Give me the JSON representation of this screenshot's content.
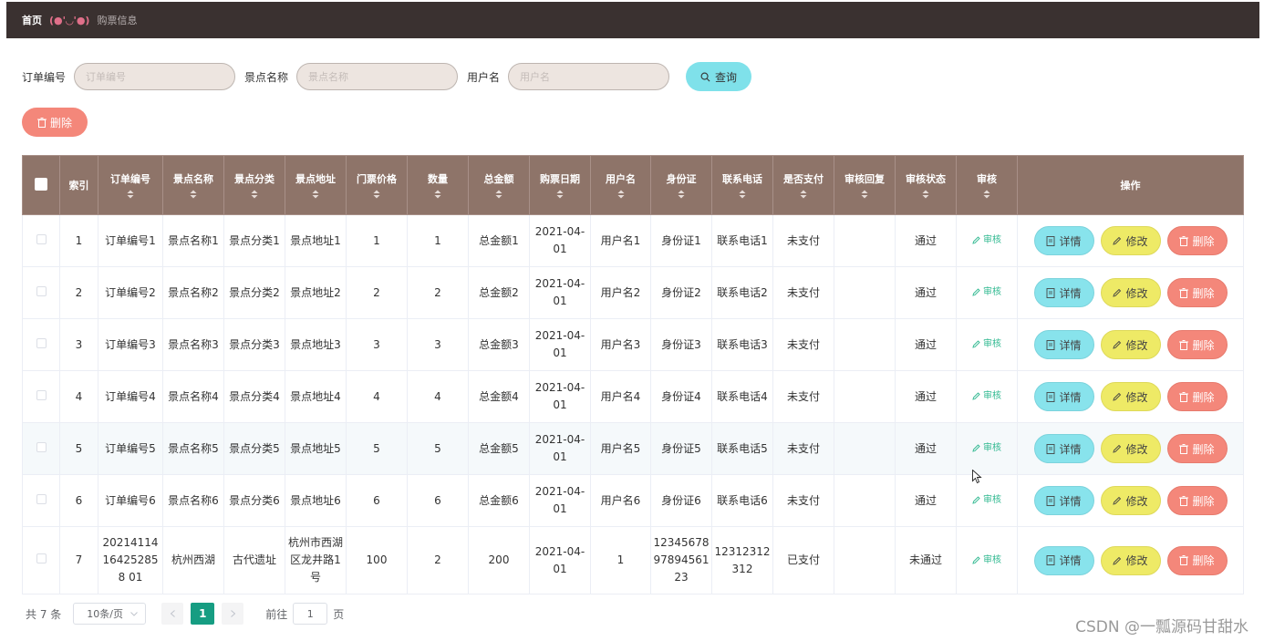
{
  "breadcrumb": {
    "home": "首页",
    "face": "(●'◡'●)",
    "current": "购票信息"
  },
  "search": {
    "order_label": "订单编号",
    "order_placeholder": "订单编号",
    "spot_label": "景点名称",
    "spot_placeholder": "景点名称",
    "user_label": "用户名",
    "user_placeholder": "用户名",
    "query_label": "查询"
  },
  "toolbar": {
    "delete_label": "删除"
  },
  "table": {
    "headers": [
      "索引",
      "订单编号",
      "景点名称",
      "景点分类",
      "景点地址",
      "门票价格",
      "数量",
      "总金额",
      "购票日期",
      "用户名",
      "身份证",
      "联系电话",
      "是否支付",
      "审核回复",
      "审核状态",
      "审核",
      "操作"
    ],
    "rows": [
      {
        "index": "1",
        "order": "订单编号1",
        "spot": "景点名称1",
        "category": "景点分类1",
        "address": "景点地址1",
        "price": "1",
        "qty": "1",
        "total": "总金额1",
        "date": "2021-04-01",
        "user": "用户名1",
        "id_card": "身份证1",
        "phone": "联系电话1",
        "paid": "未支付",
        "reply": "",
        "status": "通过",
        "audit": "审核"
      },
      {
        "index": "2",
        "order": "订单编号2",
        "spot": "景点名称2",
        "category": "景点分类2",
        "address": "景点地址2",
        "price": "2",
        "qty": "2",
        "total": "总金额2",
        "date": "2021-04-01",
        "user": "用户名2",
        "id_card": "身份证2",
        "phone": "联系电话2",
        "paid": "未支付",
        "reply": "",
        "status": "通过",
        "audit": "审核"
      },
      {
        "index": "3",
        "order": "订单编号3",
        "spot": "景点名称3",
        "category": "景点分类3",
        "address": "景点地址3",
        "price": "3",
        "qty": "3",
        "total": "总金额3",
        "date": "2021-04-01",
        "user": "用户名3",
        "id_card": "身份证3",
        "phone": "联系电话3",
        "paid": "未支付",
        "reply": "",
        "status": "通过",
        "audit": "审核"
      },
      {
        "index": "4",
        "order": "订单编号4",
        "spot": "景点名称4",
        "category": "景点分类4",
        "address": "景点地址4",
        "price": "4",
        "qty": "4",
        "total": "总金额4",
        "date": "2021-04-01",
        "user": "用户名4",
        "id_card": "身份证4",
        "phone": "联系电话4",
        "paid": "未支付",
        "reply": "",
        "status": "通过",
        "audit": "审核"
      },
      {
        "index": "5",
        "order": "订单编号5",
        "spot": "景点名称5",
        "category": "景点分类5",
        "address": "景点地址5",
        "price": "5",
        "qty": "5",
        "total": "总金额5",
        "date": "2021-04-01",
        "user": "用户名5",
        "id_card": "身份证5",
        "phone": "联系电话5",
        "paid": "未支付",
        "reply": "",
        "status": "通过",
        "audit": "审核"
      },
      {
        "index": "6",
        "order": "订单编号6",
        "spot": "景点名称6",
        "category": "景点分类6",
        "address": "景点地址6",
        "price": "6",
        "qty": "6",
        "total": "总金额6",
        "date": "2021-04-01",
        "user": "用户名6",
        "id_card": "身份证6",
        "phone": "联系电话6",
        "paid": "未支付",
        "reply": "",
        "status": "通过",
        "audit": "审核"
      },
      {
        "index": "7",
        "order": "20214114164252858 01",
        "spot": "杭州西湖",
        "category": "古代遗址",
        "address": "杭州市西湖区龙井路1号",
        "price": "100",
        "qty": "2",
        "total": "200",
        "date": "2021-04-01",
        "user": "1",
        "id_card": "123456789789456123",
        "phone": "12312312312",
        "paid": "已支付",
        "reply": "",
        "status": "未通过",
        "audit": "审核"
      }
    ],
    "actions": {
      "detail": "详情",
      "edit": "修改",
      "delete": "删除"
    }
  },
  "pagination": {
    "total": "共 7 条",
    "page_size": "10条/页",
    "current_page": "1",
    "goto_label": "前往",
    "goto_value": "1",
    "page_suffix": "页"
  },
  "watermark": "CSDN @一瓢源码甘甜水",
  "colors": {
    "header_bg": "#8e7469",
    "topbar": "#3a3130",
    "query": "#7fe1ea",
    "detail": "#88e3ec",
    "edit": "#eeea66",
    "delete": "#f4877a",
    "page_active": "#169d82"
  }
}
